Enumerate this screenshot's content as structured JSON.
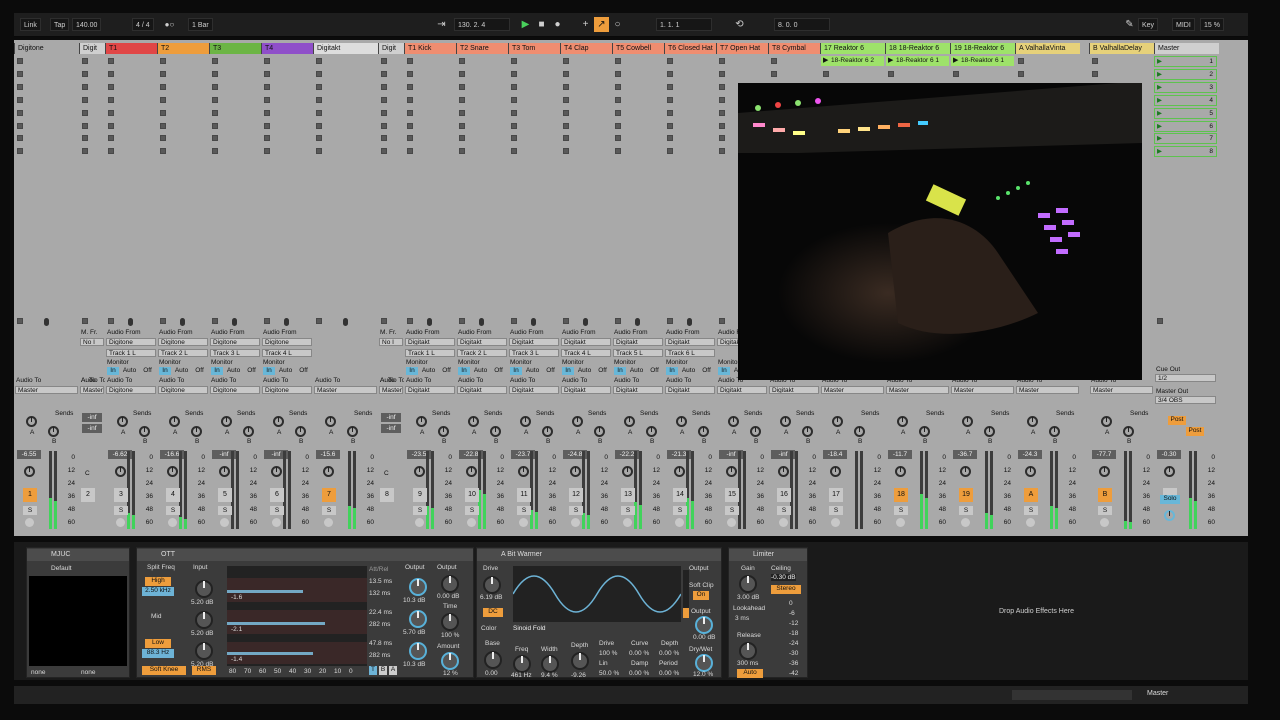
{
  "transport": {
    "link": "Link",
    "tap": "Tap",
    "tempo": "140.00",
    "signature": "4 / 4",
    "quantize": "1 Bar",
    "position": "130.  2.  4",
    "loop_start": "1.  1.  1",
    "loop_length": "8.  0.  0",
    "key": "Key",
    "midi": "MIDI",
    "cpu": "15 %",
    "play_icon": "play-icon",
    "stop_icon": "stop-icon",
    "record_icon": "record-icon"
  },
  "tracks": [
    {
      "name": "Digitone",
      "color": "#a9a9a9",
      "kind": "group"
    },
    {
      "name": "Digit",
      "color": "#cfcfcf",
      "kind": "fold"
    },
    {
      "name": "T1",
      "color": "#e04646",
      "kind": "midi",
      "src": "Digitone",
      "ch": "Track 1 L",
      "num": "3",
      "vol": "-6.62",
      "ml": 0.2
    },
    {
      "name": "T2",
      "color": "#ee9d3c",
      "kind": "midi",
      "src": "Digitone",
      "ch": "Track 2 L",
      "num": "4",
      "vol": "-16.6",
      "ml": 0.15
    },
    {
      "name": "T3",
      "color": "#6cb545",
      "kind": "midi",
      "src": "Digitone",
      "ch": "Track 3 L",
      "num": "5",
      "vol": "-inf",
      "ml": 0
    },
    {
      "name": "T4",
      "color": "#8f4fc9",
      "kind": "midi",
      "src": "Digitone",
      "ch": "Track 4 L",
      "num": "6",
      "vol": "-inf",
      "ml": 0
    },
    {
      "name": "Digitakt",
      "color": "#dddddd",
      "kind": "group"
    },
    {
      "name": "Digit",
      "color": "#cfcfcf",
      "kind": "fold"
    },
    {
      "name": "T1 Kick",
      "color": "#ef8d70",
      "kind": "midi",
      "src": "Digitakt",
      "ch": "Track 1 L",
      "num": "9",
      "vol": "-23.5",
      "ml": 0.3
    },
    {
      "name": "T2 Snare",
      "color": "#ef8d70",
      "kind": "midi",
      "src": "Digitakt",
      "ch": "Track 2 L",
      "num": "10",
      "vol": "-22.8",
      "ml": 0.5
    },
    {
      "name": "T3 Tom",
      "color": "#ef8d70",
      "kind": "midi",
      "src": "Digitakt",
      "ch": "Track 3 L",
      "num": "11",
      "vol": "-23.7",
      "ml": 0.25
    },
    {
      "name": "T4 Clap",
      "color": "#ef8d70",
      "kind": "midi",
      "src": "Digitakt",
      "ch": "Track 4 L",
      "num": "12",
      "vol": "-24.8",
      "ml": 0.2
    },
    {
      "name": "T5 Cowbell",
      "color": "#ef8d70",
      "kind": "midi",
      "src": "Digitakt",
      "ch": "Track 5 L",
      "num": "13",
      "vol": "-22.2",
      "ml": 0.35
    },
    {
      "name": "T6 Closed Hat",
      "color": "#ef8d70",
      "kind": "midi",
      "src": "Digitakt",
      "ch": "Track 6 L",
      "num": "14",
      "vol": "-21.3",
      "ml": 0.4
    },
    {
      "name": "T7 Open Hat",
      "color": "#ef8d70",
      "kind": "midi",
      "src": "Digitakt",
      "ch": "",
      "num": "15",
      "vol": "-inf",
      "ml": 0
    },
    {
      "name": "T8 Cymbal",
      "color": "#ef8d70",
      "kind": "midi",
      "src": "Digitakt",
      "ch": "",
      "num": "16",
      "vol": "-inf",
      "ml": 0
    },
    {
      "name": "17 Reaktor 6",
      "color": "#9ee26a",
      "kind": "inst",
      "clip": "18-Reaktor 6 2",
      "num": "17",
      "vol": "-18.4",
      "ml": 0
    },
    {
      "name": "18 18-Reaktor 6",
      "color": "#9ee26a",
      "kind": "inst",
      "clip": "18-Reaktor 6 1",
      "num": "18",
      "vol": "-11.7",
      "ml": 0.45
    },
    {
      "name": "19 18-Reaktor 6",
      "color": "#9ee26a",
      "kind": "inst",
      "clip": "18-Reaktor 6 1",
      "num": "19",
      "vol": "-36.7",
      "ml": 0.2
    },
    {
      "name": "A ValhallaVinta",
      "color": "#e6d17a",
      "kind": "return",
      "num": "A",
      "vol": "-24.3",
      "ml": 0.3
    },
    {
      "name": "B ValhallaDelay",
      "color": "#e6d17a",
      "kind": "return",
      "num": "B",
      "vol": "-77.7",
      "ml": 0.1
    },
    {
      "name": "Master",
      "color": "#cfcfcf",
      "kind": "master",
      "vol": "-0.30",
      "ml": 0.4
    }
  ],
  "group_digitone": {
    "num": "1",
    "vol": "-6.55",
    "ml": 0.4
  },
  "group_digitakt": {
    "num": "7",
    "vol": "-15.6",
    "ml": 0.3
  },
  "fold1": {
    "num": "2",
    "vol1": "-inf",
    "vol2": "-inf"
  },
  "fold2": {
    "num": "8",
    "vol1": "-inf",
    "vol2": "-inf"
  },
  "labels": {
    "audio_from": "Audio From",
    "monitor": "Monitor",
    "in": "In",
    "auto": "Auto",
    "off": "Off",
    "audio_to": "Audio To",
    "master": "Master",
    "sends": "Sends",
    "a": "A",
    "b": "B",
    "s": "S",
    "mfr": "M. Fr.",
    "noi": "No I",
    "ato": "A. To",
    "digit": "Digit",
    "c": "C",
    "cue_out": "Cue Out",
    "cue_val": "1/2",
    "master_out": "Master Out",
    "master_out_val": "3/4 OBS",
    "post": "Post",
    "solo": "Solo"
  },
  "scale": [
    "0",
    "12",
    "24",
    "36",
    "48",
    "60"
  ],
  "scenes": [
    "1",
    "2",
    "3",
    "4",
    "5",
    "6",
    "7",
    "8"
  ],
  "devices": {
    "mjuc": {
      "name": "MJUC",
      "preset": "Default",
      "in_sel": "none",
      "out_sel": "none"
    },
    "ott": {
      "name": "OTT",
      "split": "Split Freq",
      "input": "Input",
      "high": "High",
      "high_freq": "2.50 kHz",
      "mid": "Mid",
      "low": "Low",
      "low_freq": "88.3 Hz",
      "soft_knee": "Soft Knee",
      "rms": "RMS",
      "in_gain": [
        "5.20 dB",
        "5.20 dB",
        "5.20 dB"
      ],
      "bars": [
        "-1.6",
        "-2.1",
        "-1.4"
      ],
      "attrel": "Att/Rel",
      "times": [
        "13.5 ms",
        "132 ms",
        "22.4 ms",
        "282 ms",
        "47.8 ms",
        "282 ms"
      ],
      "output": "Output",
      "out_gain": [
        "10.3 dB",
        "5.70 dB",
        "10.3 dB"
      ],
      "output2": "Output",
      "output_val": "0.00 dB",
      "time": "Time",
      "time_val": "100 %",
      "amount": "Amount",
      "amount_val": "12 %",
      "axis": [
        "80",
        "70",
        "60",
        "50",
        "40",
        "30",
        "20",
        "10",
        "0"
      ],
      "t": "T",
      "b": "B",
      "a": "A"
    },
    "warmer": {
      "name": "A Bit Warmer",
      "drive": "Drive",
      "drive_val": "6.19 dB",
      "dc": "DC",
      "color": "Color",
      "mode": "Sinoid Fold",
      "output": "Output",
      "soft_clip": "Soft Clip",
      "soft_clip_val": "On",
      "output_label": "Output",
      "output_val": "0.00 dB",
      "drywet": "Dry/Wet",
      "drywet_val": "12.0 %",
      "base": "Base",
      "base_val": "0.00",
      "freq": "Freq",
      "freq_val": "461 Hz",
      "width": "Width",
      "width_val": "9.4 %",
      "depth": "Depth",
      "depth_val": "-9.26",
      "drive2": "Drive",
      "drive2_val": "100 %",
      "curve": "Curve",
      "curve_val": "0.00 %",
      "depth2": "Depth",
      "depth2_val": "0.00 %",
      "lin": "Lin",
      "lin_val": "50.0 %",
      "damp": "Damp",
      "damp_val": "0.00 %",
      "period": "Period",
      "period_val": "0.00 %"
    },
    "limiter": {
      "name": "Limiter",
      "gain": "Gain",
      "gain_val": "3.00 dB",
      "ceiling": "Ceiling",
      "ceiling_val": "-0.30 dB",
      "stereo": "Stereo",
      "lookahead": "Lookahead",
      "lookahead_val": "3 ms",
      "release": "Release",
      "release_val": "300 ms",
      "auto": "Auto",
      "scale": [
        "0",
        "-6",
        "-12",
        "-18",
        "-24",
        "-30",
        "-36",
        "-42"
      ]
    },
    "drop": "Drop Audio Effects Here"
  },
  "status": {
    "master": "Master"
  }
}
